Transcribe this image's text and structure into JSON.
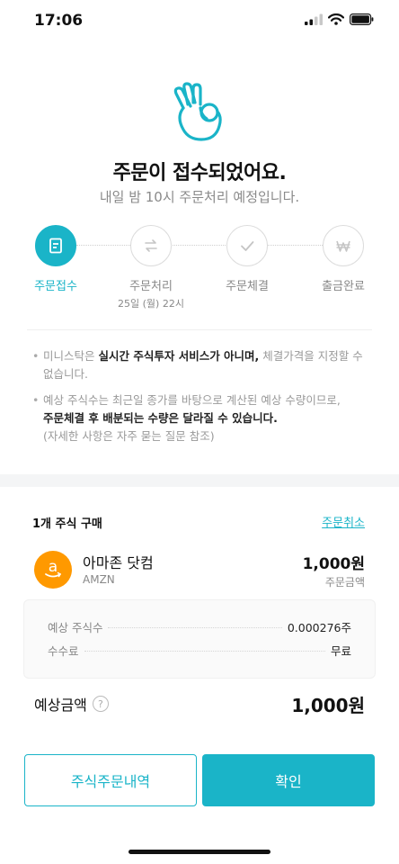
{
  "status_bar": {
    "time": "17:06"
  },
  "hero": {
    "title": "주문이 접수되었어요.",
    "subtitle": "내일 밤 10시 주문처리 예정입니다."
  },
  "steps": [
    {
      "label": "주문접수",
      "date": "",
      "icon": "receipt-icon",
      "active": true
    },
    {
      "label": "주문처리",
      "date": "25일 (월) 22시",
      "icon": "exchange-icon",
      "active": false
    },
    {
      "label": "주문체결",
      "date": "",
      "icon": "check-icon",
      "active": false
    },
    {
      "label": "출금완료",
      "date": "",
      "icon": "won-icon",
      "active": false
    }
  ],
  "notices": {
    "n1_a": "미니스탁은 ",
    "n1_b": "실시간 주식투자 서비스가 아니며,",
    "n1_c": " 체결가격을 지정할 수 없습니다.",
    "n2_a": "예상 주식수는 최근일 종가를 바탕으로 계산된 예상 수량이므로,",
    "n2_b": "주문체결 후 배분되는 수량은 달라질 수 있습니다.",
    "n2_c": "(자세한 사항은 자주 묻는 질문 참조)"
  },
  "order": {
    "heading": "1개 주식 구매",
    "cancel_label": "주문취소",
    "stock_name": "아마존 닷컴",
    "ticker": "AMZN",
    "amount": "1,000원",
    "amount_label": "주문금액",
    "details": [
      {
        "key": "예상 주식수",
        "value": "0.000276주"
      },
      {
        "key": "수수료",
        "value": "무료"
      }
    ],
    "estimate_label": "예상금액",
    "estimate_value": "1,000원"
  },
  "buttons": {
    "history": "주식주문내역",
    "confirm": "확인"
  },
  "colors": {
    "accent": "#1ab4c8",
    "amazon": "#ff9900"
  }
}
